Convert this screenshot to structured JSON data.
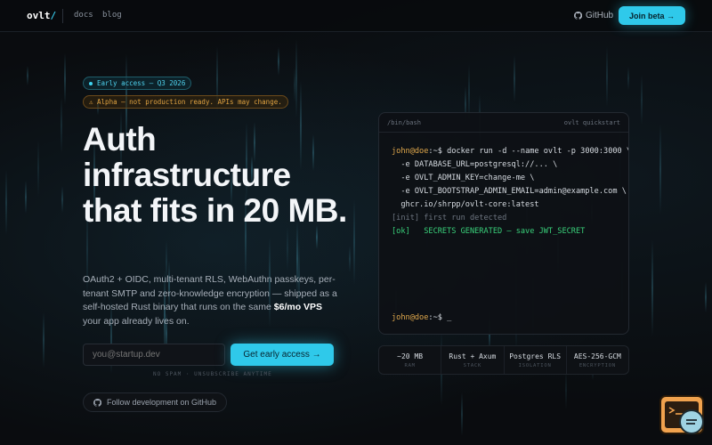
{
  "nav": {
    "logo": "ovlt",
    "logo_slash": "/",
    "links": [
      "docs",
      "blog"
    ],
    "github": "GitHub",
    "join": "Join beta →"
  },
  "hero": {
    "badge_access": "Early access — Q3 2026",
    "badge_alpha": "⚠ Alpha — not production ready. APIs may change.",
    "headline": "Auth infrastructure that fits in 20 MB.",
    "subtitle_pre": "OAuth2 + OIDC, multi-tenant RLS, WebAuthn passkeys, per-tenant SMTP and zero-knowledge encryption — shipped as a self-hosted Rust binary that runs on the same ",
    "subtitle_bold": "$6/mo VPS",
    "subtitle_post": " your app already lives on.",
    "email_placeholder": "you@startup.dev",
    "cta": "Get early access →",
    "note": "NO SPAM · UNSUBSCRIBE ANYTIME",
    "follow": "Follow development on GitHub"
  },
  "terminal": {
    "left_title": "/bin/bash",
    "right_title": "ovlt quickstart",
    "prompt": "john@doe",
    "prompt_suffix": ":~$",
    "command": " docker run -d --name ovlt -p 3000:3000 \\",
    "args": [
      "  -e DATABASE_URL=postgresql://... \\",
      "  -e OVLT_ADMIN_KEY=change-me \\",
      "  -e OVLT_BOOTSTRAP_ADMIN_EMAIL=admin@example.com \\",
      "  ghcr.io/shrpp/ovlt-core:latest"
    ],
    "init_line": "[init] first run detected",
    "ok_tag": "[ok]",
    "ok_text": "   SECRETS GENERATED — save JWT_SECRET",
    "cursor": " _"
  },
  "stats": [
    {
      "value": "~20 MB",
      "label": "RAM"
    },
    {
      "value": "Rust + Axum",
      "label": "STACK"
    },
    {
      "value": "Postgres RLS",
      "label": "ISOLATION"
    },
    {
      "value": "AES-256-GCM",
      "label": "ENCRYPTION"
    }
  ],
  "colors": {
    "accent": "#2fc9ea",
    "warning": "#e0a241",
    "ok": "#39d07a",
    "prompt": "#e0a84c"
  }
}
